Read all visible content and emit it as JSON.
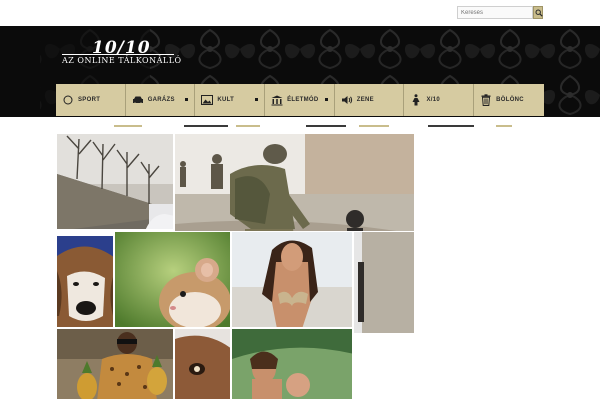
{
  "search": {
    "placeholder": "Keresés"
  },
  "logo": {
    "mark": "10/10",
    "tagline": "AZ ONLINE TÁLKONÁLLÓ"
  },
  "nav": [
    {
      "label": "SPORT",
      "icon": "circle-icon"
    },
    {
      "label": "GARÁZS",
      "icon": "car-icon"
    },
    {
      "label": "KULT",
      "icon": "picture-icon"
    },
    {
      "label": "ÉLETMÓD",
      "icon": "bank-icon"
    },
    {
      "label": "ZENE",
      "icon": "speaker-icon"
    },
    {
      "label": "X/10",
      "icon": "woman-icon"
    },
    {
      "label": "BÖLÖNC",
      "icon": "trash-icon"
    }
  ],
  "colors": {
    "nav_bg": "#d6cba1",
    "header_bg": "#0d0d0d",
    "accent": "#c9bd8c"
  },
  "photos": [
    {
      "name": "photo-winter-street"
    },
    {
      "name": "photo-soldiers"
    },
    {
      "name": "photo-dog"
    },
    {
      "name": "photo-hamster"
    },
    {
      "name": "photo-bikini-woman"
    },
    {
      "name": "photo-pineapple-man"
    },
    {
      "name": "photo-animal-closeup"
    },
    {
      "name": "photo-beach-children"
    }
  ]
}
